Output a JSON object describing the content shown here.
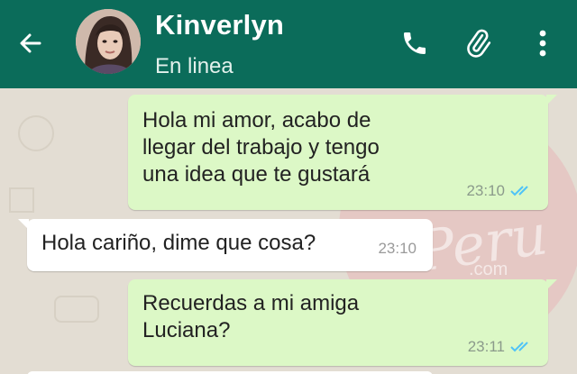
{
  "header": {
    "contact_name": "Kinverlyn",
    "status": "En linea",
    "icons": {
      "back": "arrow-left-icon",
      "call": "phone-icon",
      "attach": "paperclip-icon",
      "menu": "more-vert-icon"
    },
    "color": "#0b6c5a"
  },
  "messages": [
    {
      "direction": "outgoing",
      "text": "Hola mi amor, acabo de\nllegar del trabajo y tengo\nuna idea que te gustará",
      "time": "23:10",
      "read_receipt": "double-check-icon"
    },
    {
      "direction": "incoming",
      "text": "Hola cariño, dime que cosa?",
      "time": "23:10"
    },
    {
      "direction": "outgoing",
      "text": "Recuerdas a mi amiga\nLuciana?",
      "time": "23:11",
      "read_receipt": "double-check-icon"
    }
  ],
  "watermark": {
    "main": "Peru",
    "sub": ".com"
  },
  "colors": {
    "outgoing_bubble": "#dcf8c6",
    "incoming_bubble": "#ffffff",
    "read_tick": "#4fc3f7"
  }
}
